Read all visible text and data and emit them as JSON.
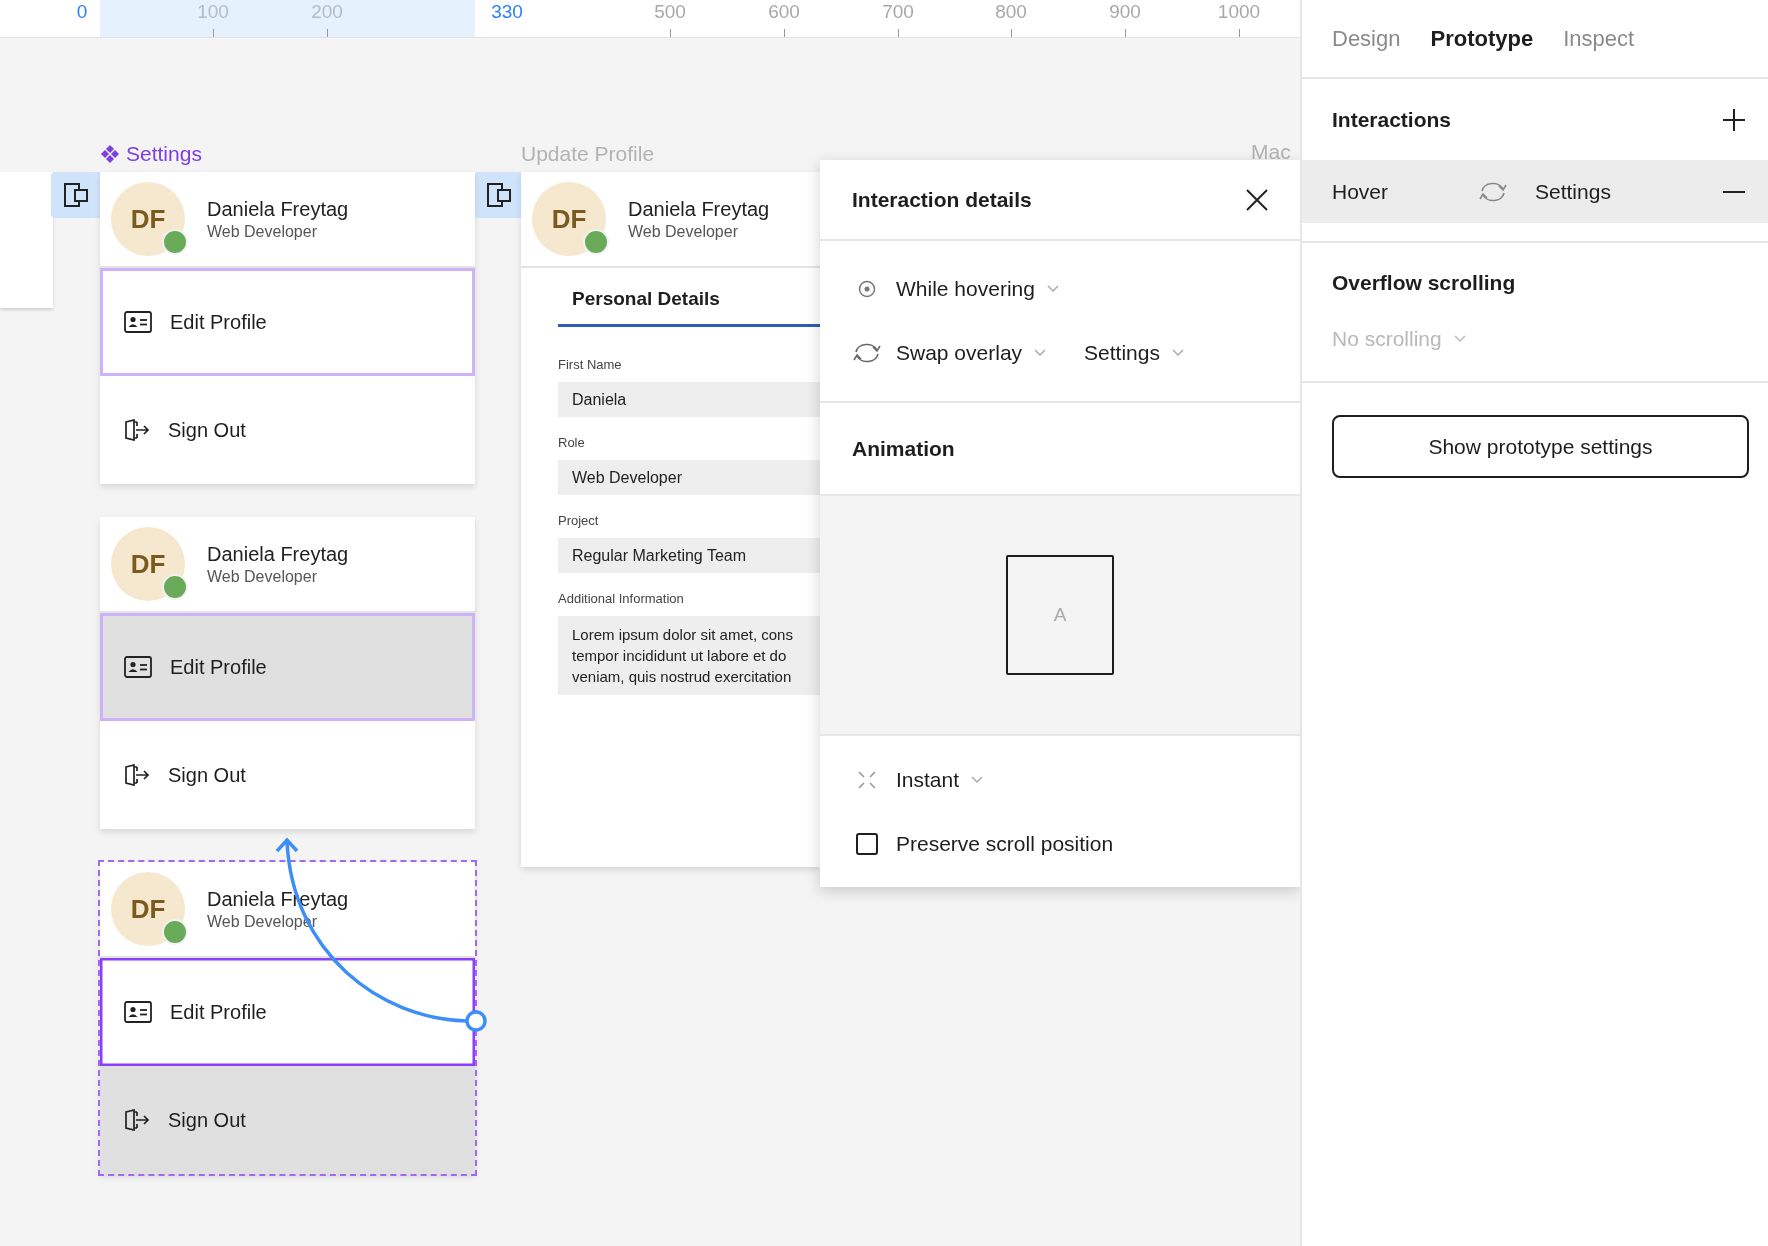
{
  "ruler": {
    "marks": [
      {
        "label": "0",
        "kind": "bound"
      },
      {
        "label": "100",
        "kind": "inner"
      },
      {
        "label": "200",
        "kind": "inner"
      },
      {
        "label": "330",
        "kind": "bound"
      },
      {
        "label": "500",
        "kind": "tick"
      },
      {
        "label": "600",
        "kind": "tick"
      },
      {
        "label": "700",
        "kind": "tick"
      },
      {
        "label": "800",
        "kind": "tick"
      },
      {
        "label": "900",
        "kind": "tick"
      },
      {
        "label": "1000",
        "kind": "tick"
      }
    ]
  },
  "canvas": {
    "component": {
      "title": "Settings",
      "variants": [
        {
          "selected": false,
          "initials": "DF",
          "name": "Daniela Freytag",
          "role": "Web Developer",
          "online": true,
          "items": [
            {
              "kind": "edit",
              "label": "Edit Profile",
              "hovered": false,
              "highlighted": true,
              "selected": false
            },
            {
              "kind": "signout",
              "label": "Sign Out",
              "hovered": false,
              "highlighted": false,
              "selected": false
            }
          ]
        },
        {
          "selected": false,
          "initials": "DF",
          "name": "Daniela Freytag",
          "role": "Web Developer",
          "online": true,
          "items": [
            {
              "kind": "edit",
              "label": "Edit Profile",
              "hovered": true,
              "highlighted": true,
              "selected": false
            },
            {
              "kind": "signout",
              "label": "Sign Out",
              "hovered": false,
              "highlighted": false,
              "selected": false
            }
          ]
        },
        {
          "selected": true,
          "initials": "DF",
          "name": "Daniela Freytag",
          "role": "Web Developer",
          "online": true,
          "items": [
            {
              "kind": "edit",
              "label": "Edit Profile",
              "hovered": false,
              "highlighted": false,
              "selected": true
            },
            {
              "kind": "signout",
              "label": "Sign Out",
              "hovered": true,
              "highlighted": false,
              "selected": false
            }
          ]
        }
      ]
    },
    "profile_frame": {
      "title": "Update Profile",
      "initials": "DF",
      "name": "Daniela Freytag",
      "role": "Web Developer",
      "online": true,
      "tab": {
        "label": "Personal Details",
        "selected": true
      },
      "fields": [
        {
          "kind": "input",
          "label": "First Name",
          "value": "Daniela"
        },
        {
          "kind": "input",
          "label": "Role",
          "value": "Web Developer"
        },
        {
          "kind": "input",
          "label": "Project",
          "value": "Regular Marketing Team"
        },
        {
          "kind": "textarea",
          "label": "Additional Information",
          "lines": [
            "Lorem ipsum dolor sit amet, cons",
            "tempor incididunt ut labore et do",
            "veniam, quis nostrud exercitation"
          ]
        }
      ]
    },
    "other_frame": {
      "title": "Mac"
    }
  },
  "dialog": {
    "title": "Interaction details",
    "trigger": "While hovering",
    "action": "Swap overlay",
    "destination": "Settings",
    "animation_title": "Animation",
    "preview_label": "A",
    "transition": "Instant",
    "preserve_scroll": {
      "label": "Preserve scroll position",
      "checked": false
    }
  },
  "panel": {
    "tabs": [
      {
        "label": "Design",
        "selected": false
      },
      {
        "label": "Prototype",
        "selected": true
      },
      {
        "label": "Inspect",
        "selected": false
      }
    ],
    "interactions_title": "Interactions",
    "interactions": [
      {
        "trigger": "Hover",
        "target": "Settings",
        "selected": true
      }
    ],
    "overflow_title": "Overflow scrolling",
    "overflow": {
      "value": "No scrolling",
      "disabled": true
    },
    "button": "Show prototype settings"
  }
}
